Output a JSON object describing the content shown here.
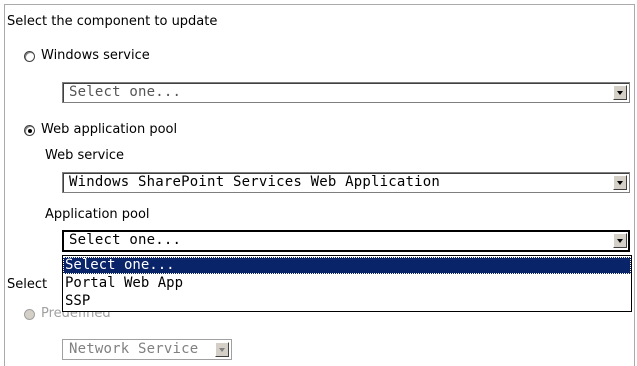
{
  "section_component": {
    "heading": "Select the component to update",
    "windows_service": {
      "label": "Windows service",
      "selected": false,
      "dropdown_value": "Select one..."
    },
    "web_app_pool": {
      "label": "Web application pool",
      "selected": true,
      "web_service_label": "Web service",
      "web_service_value": "Windows SharePoint Services Web Application",
      "app_pool_label": "Application pool",
      "app_pool_value": "Select one...",
      "app_pool_options": [
        "Select one...",
        "Portal Web App",
        "SSP"
      ],
      "app_pool_highlighted_index": 0
    }
  },
  "section_account": {
    "heading_partial": "Select",
    "predefined_label": "Predefined",
    "predefined_selected": false,
    "predefined_value": "Network Service"
  },
  "colors": {
    "highlight": "#0a246a",
    "disabled_text": "#a0a0a0",
    "border": "#aaaaaa"
  }
}
